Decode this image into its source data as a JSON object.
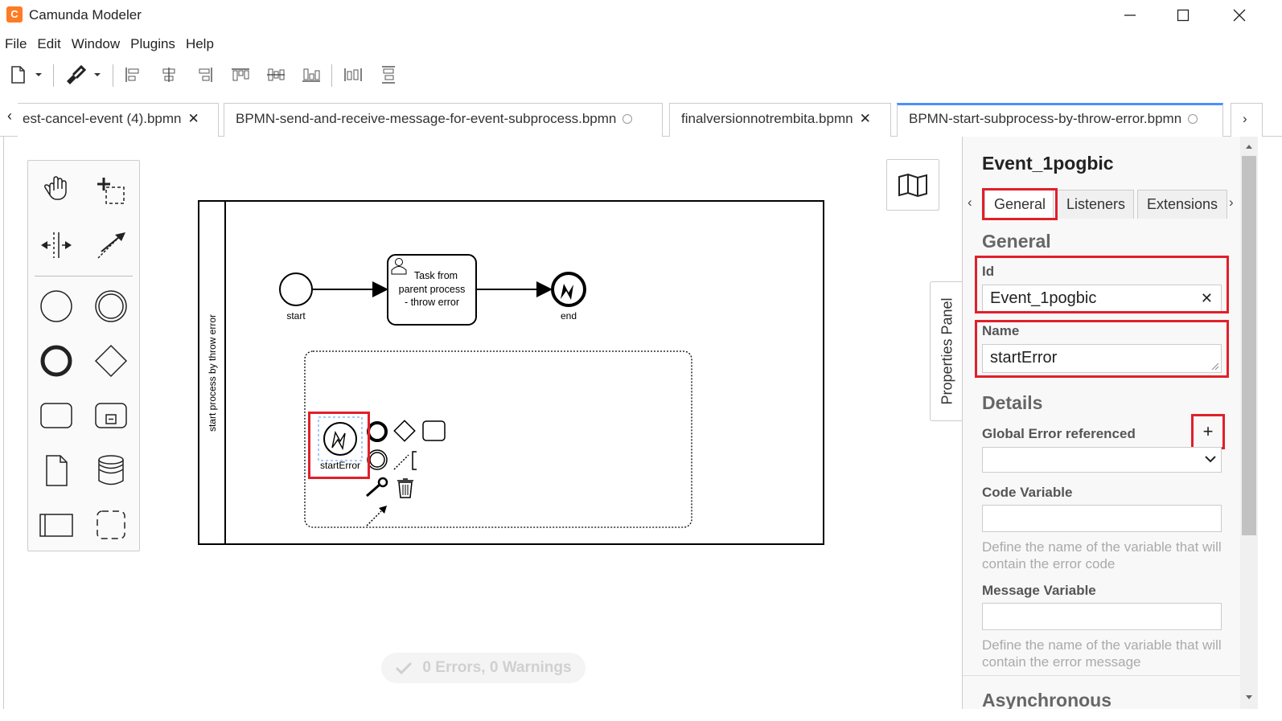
{
  "window": {
    "title": "Camunda Modeler",
    "app_icon_letter": "C",
    "accent": "#ff7b24"
  },
  "menu": [
    "File",
    "Edit",
    "Window",
    "Plugins",
    "Help"
  ],
  "toolbar": {
    "icons": [
      "new-file-icon",
      "dropdown-icon",
      "paint-brush-icon",
      "dropdown-icon",
      "align-left-icon",
      "align-center-icon",
      "align-right-icon",
      "align-top-icon",
      "align-middle-icon",
      "align-bottom-icon",
      "distribute-horizontal-icon",
      "distribute-vertical-icon"
    ]
  },
  "tabs": [
    {
      "label": "est-cancel-event (4).bpmn",
      "state": "close"
    },
    {
      "label": "BPMN-send-and-receive-message-for-event-subprocess.bpmn",
      "state": "unsaved"
    },
    {
      "label": "finalversionnotrembita.bpmn",
      "state": "close"
    },
    {
      "label": "BPMN-start-subprocess-by-throw-error.bpmn",
      "state": "unsaved",
      "active": true
    }
  ],
  "diagram": {
    "pool_label": "start process by throw error",
    "start_label": "start",
    "task_label_lines": [
      "Task from",
      "parent process",
      "- throw error"
    ],
    "end_label": "end",
    "error_start_label": "startError"
  },
  "status": {
    "errors": "0 Errors, 0 Warnings"
  },
  "properties": {
    "toggle_label": "Properties Panel",
    "title": "Event_1pogbic",
    "tabs": [
      "General",
      "Listeners",
      "Extensions"
    ],
    "general_heading": "General",
    "id_label": "Id",
    "id_value": "Event_1pogbic",
    "name_label": "Name",
    "name_value": "startError",
    "details_heading": "Details",
    "global_error_label": "Global Error referenced",
    "global_error_value": "",
    "code_var_label": "Code Variable",
    "code_var_value": "",
    "code_var_desc": "Define the name of the variable that will contain the error code",
    "msg_var_label": "Message Variable",
    "msg_var_value": "",
    "msg_var_desc": "Define the name of the variable that will contain the error message",
    "async_heading": "Asynchronous"
  },
  "highlight_color": "#e0202a"
}
